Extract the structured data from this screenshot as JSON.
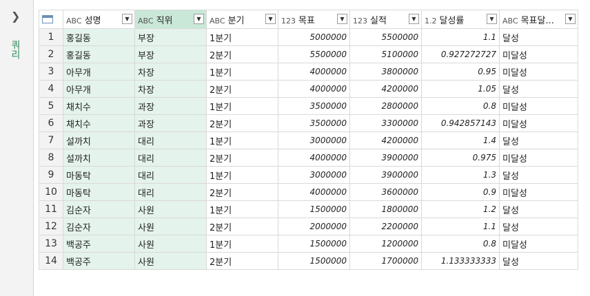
{
  "sidebar": {
    "label": "쿼리"
  },
  "columns": [
    {
      "type": "ABC",
      "name": "성명"
    },
    {
      "type": "ABC",
      "name": "직위"
    },
    {
      "type": "ABC",
      "name": "분기"
    },
    {
      "type": "123",
      "name": "목표"
    },
    {
      "type": "123",
      "name": "실적"
    },
    {
      "type": "1.2",
      "name": "달성률"
    },
    {
      "type": "ABC",
      "name": "목표달..."
    }
  ],
  "rows": [
    [
      "1",
      "홍길동",
      "부장",
      "1분기",
      "5000000",
      "5500000",
      "1.1",
      "달성"
    ],
    [
      "2",
      "홍길동",
      "부장",
      "2분기",
      "5500000",
      "5100000",
      "0.927272727",
      "미달성"
    ],
    [
      "3",
      "아무개",
      "차장",
      "1분기",
      "4000000",
      "3800000",
      "0.95",
      "미달성"
    ],
    [
      "4",
      "아무개",
      "차장",
      "2분기",
      "4000000",
      "4200000",
      "1.05",
      "달성"
    ],
    [
      "5",
      "채치수",
      "과장",
      "1분기",
      "3500000",
      "2800000",
      "0.8",
      "미달성"
    ],
    [
      "6",
      "채치수",
      "과장",
      "2분기",
      "3500000",
      "3300000",
      "0.942857143",
      "미달성"
    ],
    [
      "7",
      "설까치",
      "대리",
      "1분기",
      "3000000",
      "4200000",
      "1.4",
      "달성"
    ],
    [
      "8",
      "설까치",
      "대리",
      "2분기",
      "4000000",
      "3900000",
      "0.975",
      "미달성"
    ],
    [
      "9",
      "마동탁",
      "대리",
      "1분기",
      "3000000",
      "3900000",
      "1.3",
      "달성"
    ],
    [
      "10",
      "마동탁",
      "대리",
      "2분기",
      "4000000",
      "3600000",
      "0.9",
      "미달성"
    ],
    [
      "11",
      "김순자",
      "사원",
      "1분기",
      "1500000",
      "1800000",
      "1.2",
      "달성"
    ],
    [
      "12",
      "김순자",
      "사원",
      "2분기",
      "2000000",
      "2200000",
      "1.1",
      "달성"
    ],
    [
      "13",
      "백공주",
      "사원",
      "1분기",
      "1500000",
      "1200000",
      "0.8",
      "미달성"
    ],
    [
      "14",
      "백공주",
      "사원",
      "2분기",
      "1500000",
      "1700000",
      "1.133333333",
      "달성"
    ]
  ]
}
